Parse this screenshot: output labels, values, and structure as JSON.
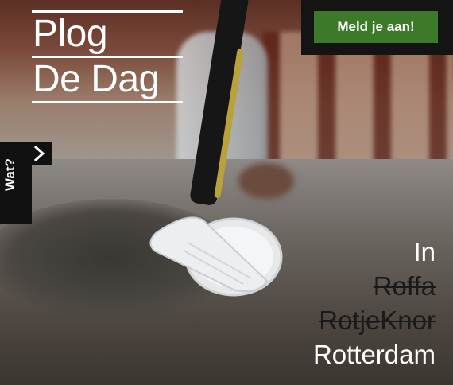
{
  "logo": {
    "line1": "Plog",
    "line2": "De Dag"
  },
  "cta": {
    "label": "Meld je aan!"
  },
  "side_tab": {
    "label": "Wat?",
    "icon": "chevron-right-icon"
  },
  "city": {
    "intro": "In",
    "struck_names": [
      "Roffa",
      "RotjeKnor"
    ],
    "name": "Rotterdam"
  },
  "colors": {
    "accent": "#3c7a29",
    "dark": "#141414",
    "text": "#ffffff"
  }
}
